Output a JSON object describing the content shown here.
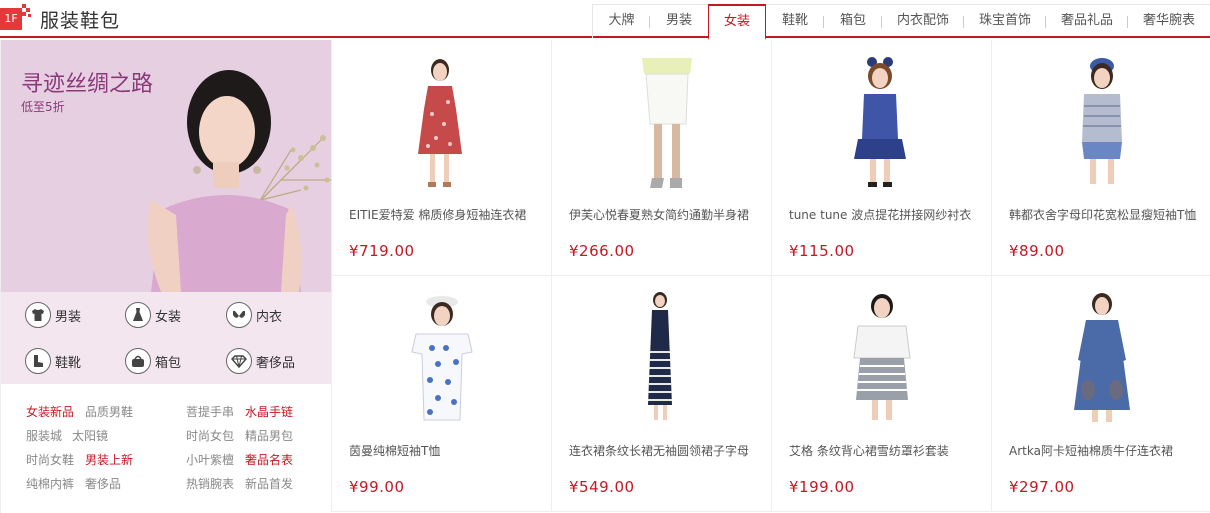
{
  "floor": {
    "badge": "1F",
    "title": "服装鞋包"
  },
  "tabs": [
    {
      "label": "大牌"
    },
    {
      "label": "男装"
    },
    {
      "label": "女装"
    },
    {
      "label": "鞋靴"
    },
    {
      "label": "箱包"
    },
    {
      "label": "内衣配饰"
    },
    {
      "label": "珠宝首饰"
    },
    {
      "label": "奢品礼品"
    },
    {
      "label": "奢华腕表"
    }
  ],
  "active_tab": "女装",
  "promo": {
    "title": "寻迹丝绸之路",
    "subtitle": "低至5折"
  },
  "categories": [
    {
      "label": "男装",
      "icon": "shirt-icon"
    },
    {
      "label": "女装",
      "icon": "dress-icon"
    },
    {
      "label": "内衣",
      "icon": "bra-icon"
    },
    {
      "label": "鞋靴",
      "icon": "boot-icon"
    },
    {
      "label": "箱包",
      "icon": "bag-icon"
    },
    {
      "label": "奢侈品",
      "icon": "diamond-icon"
    }
  ],
  "quick_links": [
    {
      "label": "女装新品",
      "highlight": true
    },
    {
      "label": "品质男鞋",
      "highlight": false
    },
    {
      "label": "菩提手串",
      "highlight": false
    },
    {
      "label": "水晶手链",
      "highlight": true
    },
    {
      "label": "服装城",
      "highlight": false
    },
    {
      "label": "太阳镜",
      "highlight": false
    },
    {
      "label": "时尚女包",
      "highlight": false
    },
    {
      "label": "精品男包",
      "highlight": false
    },
    {
      "label": "时尚女鞋",
      "highlight": false
    },
    {
      "label": "男装上新",
      "highlight": true
    },
    {
      "label": "小叶紫檀",
      "highlight": false
    },
    {
      "label": "奢品名表",
      "highlight": true
    },
    {
      "label": "纯棉内裤",
      "highlight": false
    },
    {
      "label": "奢侈品",
      "highlight": false
    },
    {
      "label": "热销腕表",
      "highlight": false
    },
    {
      "label": "新品首发",
      "highlight": false
    }
  ],
  "products": [
    {
      "name": "EITIE爱特爱 棉质修身短袖连衣裙",
      "price": "¥719.00"
    },
    {
      "name": "伊芙心悦春夏熟女简约通勤半身裙",
      "price": "¥266.00"
    },
    {
      "name": "tune tune 波点提花拼接网纱衬衣",
      "price": "¥115.00"
    },
    {
      "name": "韩都衣舍字母印花宽松显瘦短袖T恤",
      "price": "¥89.00"
    },
    {
      "name": "茵曼纯棉短袖T恤",
      "price": "¥99.00"
    },
    {
      "name": "连衣裙条纹长裙无袖圆领裙子字母",
      "price": "¥549.00"
    },
    {
      "name": "艾格 条纹背心裙雪纺罩衫套装",
      "price": "¥199.00"
    },
    {
      "name": "Artka阿卡短袖棉质牛仔连衣裙",
      "price": "¥297.00"
    }
  ],
  "colors": {
    "accent": "#c81623",
    "promo_bg": "#e6cfe0",
    "promo_text": "#8a3a7a"
  }
}
